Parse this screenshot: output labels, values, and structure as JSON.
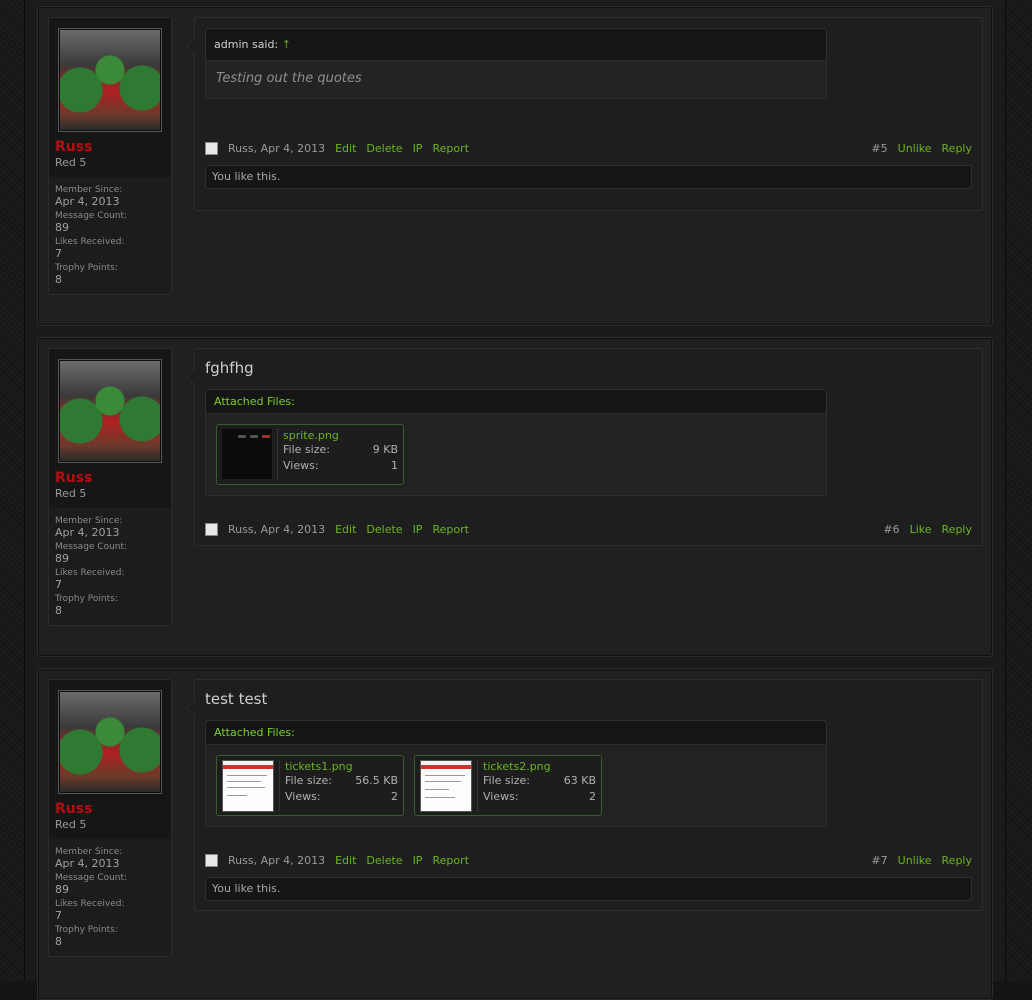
{
  "posts": [
    {
      "user": {
        "name": "Russ",
        "title": "Red 5",
        "stats": [
          {
            "k": "Member Since:",
            "v": "Apr 4, 2013"
          },
          {
            "k": "Message Count:",
            "v": "89"
          },
          {
            "k": "Likes Received:",
            "v": "7"
          },
          {
            "k": "Trophy Points:",
            "v": "8"
          }
        ]
      },
      "quote": {
        "author": "admin said:",
        "arrow": "↑",
        "text": "Testing out the quotes"
      },
      "controls": {
        "by": "Russ, Apr 4, 2013",
        "edit": "Edit",
        "delete": "Delete",
        "ip": "IP",
        "report": "Report",
        "num": "#5",
        "like": "Unlike",
        "reply": "Reply"
      },
      "likes": "You like this."
    },
    {
      "user": {
        "name": "Russ",
        "title": "Red 5",
        "stats": [
          {
            "k": "Member Since:",
            "v": "Apr 4, 2013"
          },
          {
            "k": "Message Count:",
            "v": "89"
          },
          {
            "k": "Likes Received:",
            "v": "7"
          },
          {
            "k": "Trophy Points:",
            "v": "8"
          }
        ]
      },
      "text": "fghfhg",
      "attached_title": "Attached Files:",
      "files": [
        {
          "name": "sprite.png",
          "size_label": "File size:",
          "size": "9 KB",
          "views_label": "Views:",
          "views": "1"
        }
      ],
      "controls": {
        "by": "Russ, Apr 4, 2013",
        "edit": "Edit",
        "delete": "Delete",
        "ip": "IP",
        "report": "Report",
        "num": "#6",
        "like": "Like",
        "reply": "Reply"
      }
    },
    {
      "user": {
        "name": "Russ",
        "title": "Red 5",
        "stats": [
          {
            "k": "Member Since:",
            "v": "Apr 4, 2013"
          },
          {
            "k": "Message Count:",
            "v": "89"
          },
          {
            "k": "Likes Received:",
            "v": "7"
          },
          {
            "k": "Trophy Points:",
            "v": "8"
          }
        ]
      },
      "text": "test test",
      "attached_title": "Attached Files:",
      "files": [
        {
          "name": "tickets1.png",
          "size_label": "File size:",
          "size": "56.5 KB",
          "views_label": "Views:",
          "views": "2"
        },
        {
          "name": "tickets2.png",
          "size_label": "File size:",
          "size": "63 KB",
          "views_label": "Views:",
          "views": "2"
        }
      ],
      "controls": {
        "by": "Russ, Apr 4, 2013",
        "edit": "Edit",
        "delete": "Delete",
        "ip": "IP",
        "report": "Report",
        "num": "#7",
        "like": "Unlike",
        "reply": "Reply"
      },
      "likes": "You like this."
    }
  ],
  "colors": {
    "link": "#6bb523",
    "username": "#b01010",
    "attached_header": "#7bd12a"
  }
}
